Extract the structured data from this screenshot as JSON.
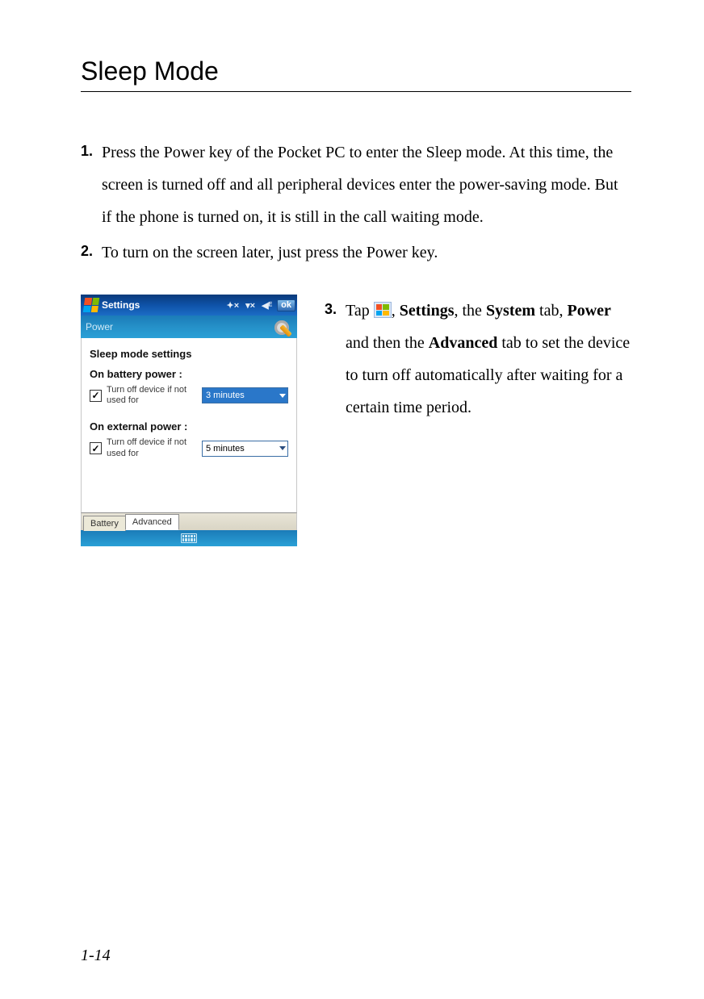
{
  "page": {
    "title": "Sleep Mode",
    "footer": "1-14"
  },
  "steps": {
    "s1_num": "1.",
    "s1_text": "Press the Power key of the Pocket PC to enter the Sleep mode. At this time, the screen is turned off and all peripheral devices enter the power-saving mode. But if the phone is turned on, it is still in the call waiting mode.",
    "s2_num": "2.",
    "s2_text": "To turn on the screen later, just press the Power key.",
    "s3_num": "3.",
    "s3_a": "Tap ",
    "s3_b": ", ",
    "s3_settings": "Settings",
    "s3_c": ", the ",
    "s3_system": "System",
    "s3_d": " tab, ",
    "s3_power": "Power",
    "s3_e": " and then the ",
    "s3_advanced": "Advanced",
    "s3_f": " tab to set the device to turn off automatically after waiting for a certain time period."
  },
  "screenshot": {
    "titlebar": {
      "title": "Settings",
      "ok": "ok"
    },
    "subbar": {
      "label": "Power"
    },
    "heading": "Sleep mode settings",
    "battery_label": "On battery power :",
    "external_label": "On external power :",
    "cb_text": "Turn off device if not used for",
    "sel_battery": "3 minutes",
    "sel_external": "5 minutes",
    "tabs": {
      "battery": "Battery",
      "advanced": "Advanced"
    }
  }
}
